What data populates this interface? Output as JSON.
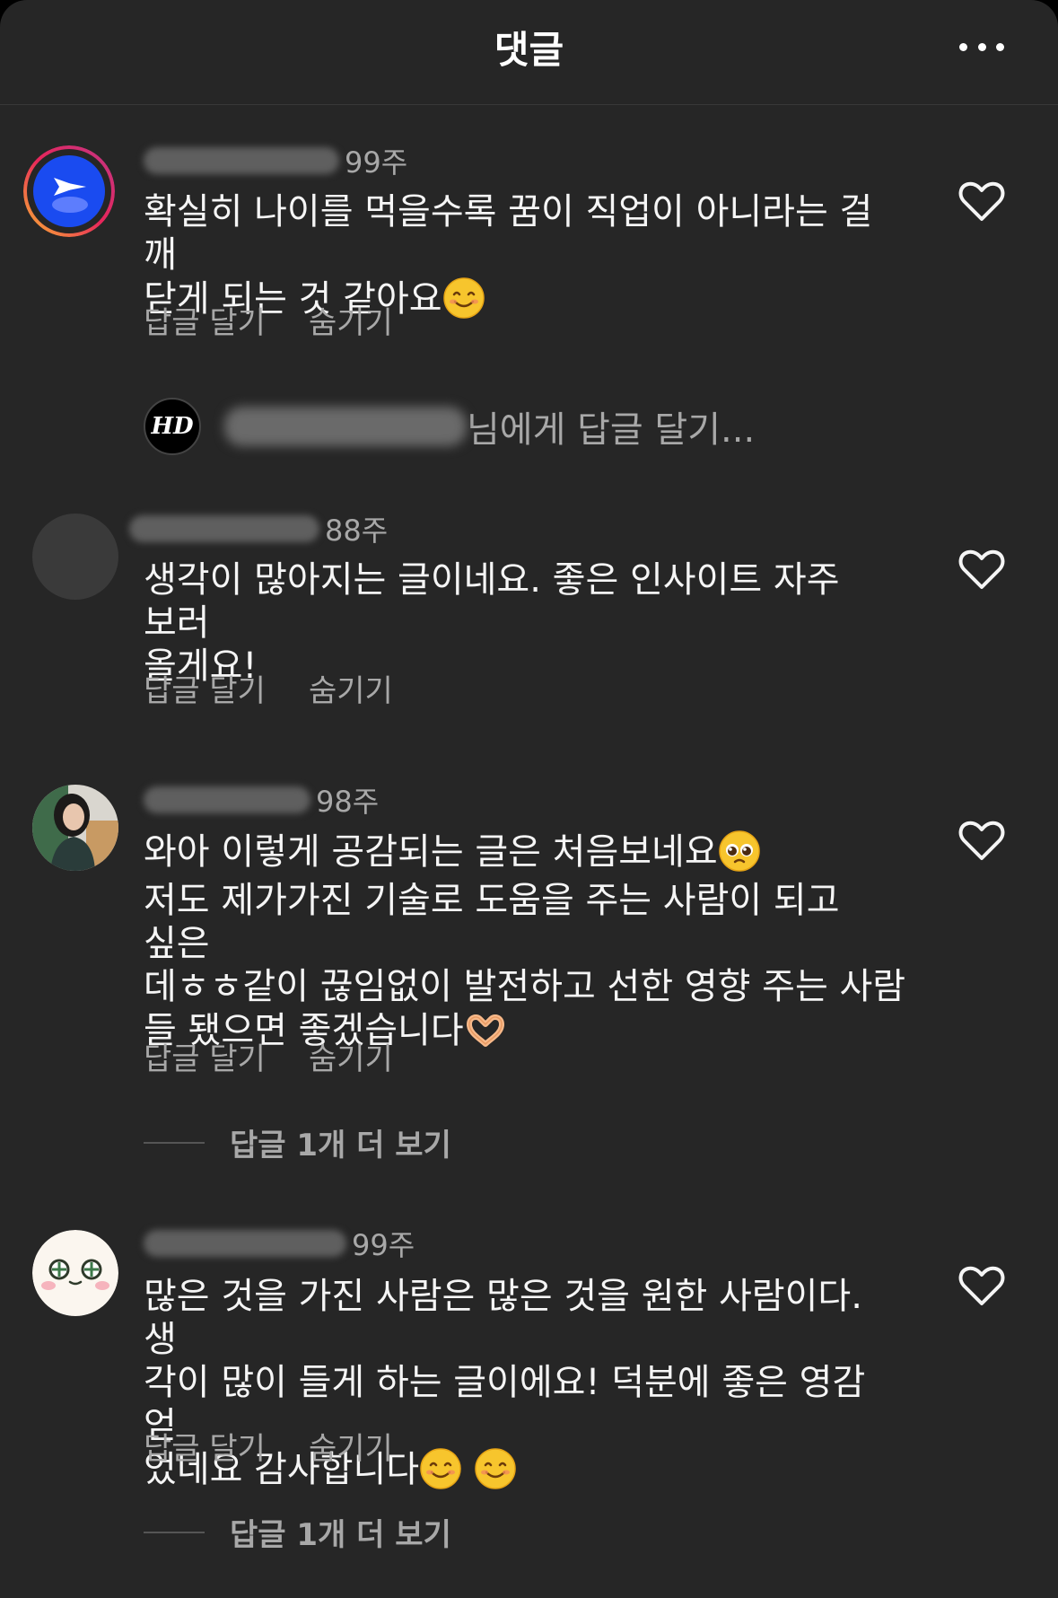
{
  "header": {
    "title": "댓글",
    "more_icon": "more-horizontal-icon"
  },
  "comments": [
    {
      "avatar": "blue-plane-logo-avatar",
      "timestamp": "99주",
      "lines": [
        "확실히 나이를 먹을수록 꿈이 직업이 아니라는 걸 깨",
        "닫게 되는 것 같아요"
      ],
      "emojis": [
        "smiling-face"
      ],
      "reply_label": "답글 달기",
      "hide_label": "숨기기"
    },
    {
      "avatar": "gray-avatar",
      "timestamp": "88주",
      "lines": [
        "생각이 많아지는 글이네요. 좋은 인사이트 자주 보러",
        "올게요!"
      ],
      "reply_label": "답글 달기",
      "hide_label": "숨기기"
    },
    {
      "avatar": "woman-photo-avatar",
      "timestamp": "98주",
      "lines": [
        "와아 이렇게 공감되는 글은 처음보네요",
        "저도 제가가진 기술로 도움을 주는 사람이 되고 싶은",
        "데ㅎㅎ같이 끊임없이 발전하고 선한 영향 주는 사람",
        "들 됐으면 좋겠습니다"
      ],
      "emojis": [
        "pleading-face",
        "heart-hands"
      ],
      "reply_label": "답글 달기",
      "hide_label": "숨기기",
      "view_replies": "답글 1개 더 보기"
    },
    {
      "avatar": "cute-face-avatar",
      "timestamp": "99주",
      "lines": [
        "많은 것을 가진 사람은 많은 것을 원한 사람이다. 생",
        "각이 많이 들게 하는 글이에요! 덕분에 좋은 영감 얻",
        "었네요 감사합니다"
      ],
      "emojis": [
        "smiling-face",
        "smiling-face"
      ],
      "reply_label": "답글 달기",
      "hide_label": "숨기기",
      "view_replies": "답글 1개 더 보기"
    }
  ],
  "reply_prompt": {
    "avatar_text": "HD",
    "placeholder": "님에게 답글 달기..."
  },
  "heart_icon": "heart-outline-icon"
}
